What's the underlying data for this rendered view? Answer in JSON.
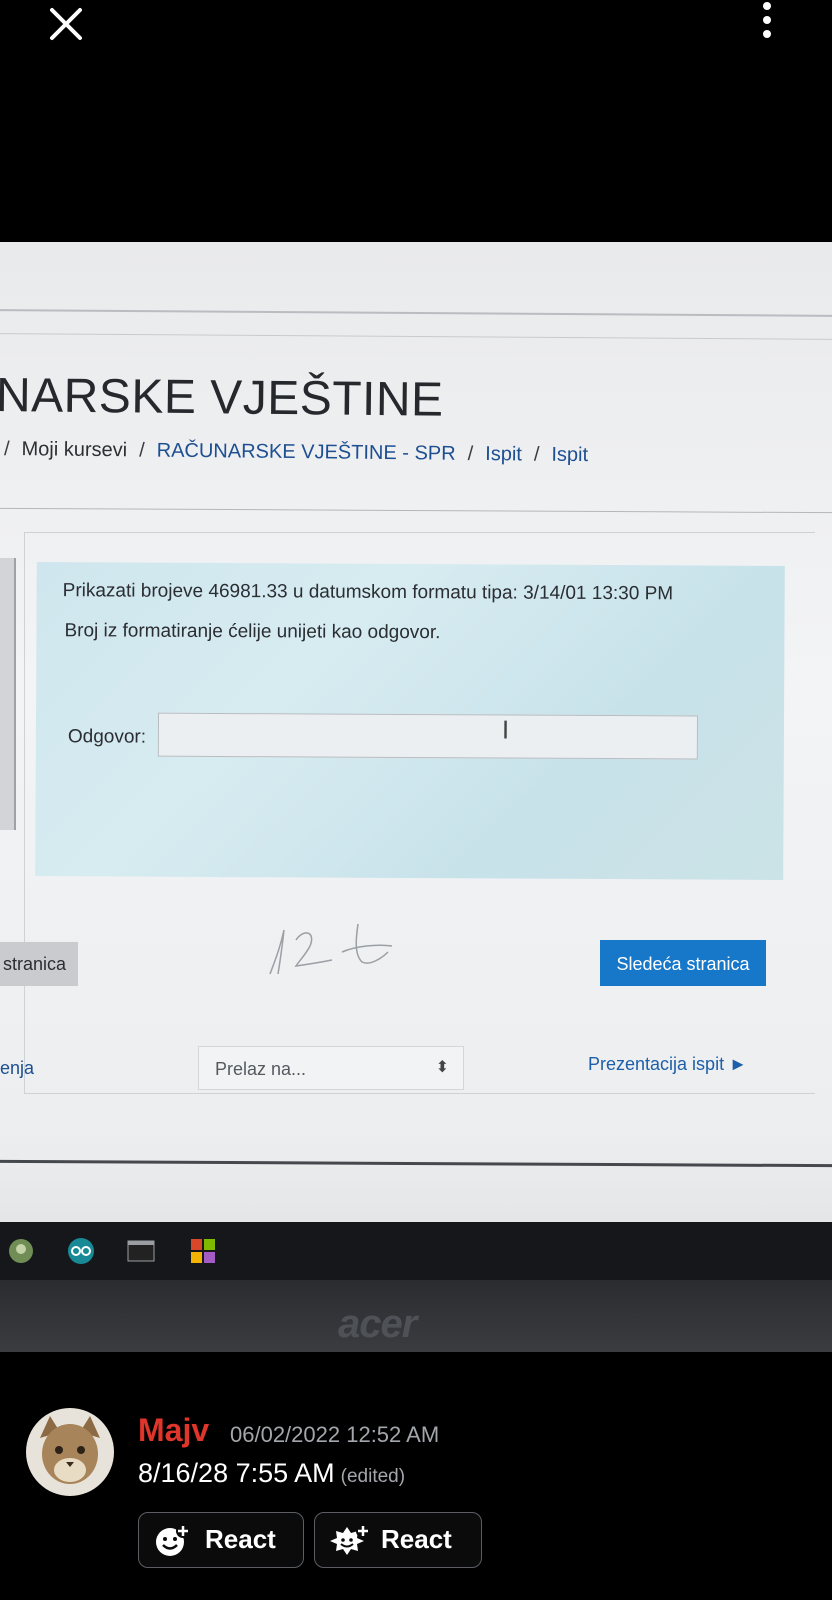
{
  "viewer": {
    "close_icon": "close-icon",
    "more_icon": "more-vertical-icon"
  },
  "screen": {
    "course_title": "NARSKE VJEŠTINE",
    "breadcrumb": [
      "Moji kursevi",
      "RAČUNARSKE VJEŠTINE - SPR",
      "Ispit",
      "Ispit"
    ],
    "question_line1": "Prikazati brojeve 46981.33 u datumskom formatu tipa: 3/14/01 13:30 PM",
    "question_line2": "Broj iz formatiranje ćelije unijeti kao odgovor.",
    "answer_label": "Odgovor:",
    "answer_value": "",
    "prev_button": "stranica",
    "next_button": "Sledeća stranica",
    "nav_left_link": "enja",
    "jump_select": "Prelaz na...",
    "nav_right_link": "Prezentacija ispit ►",
    "bezel_brand": "acer"
  },
  "message": {
    "author": "Majv",
    "author_color": "#e0352a",
    "timestamp": "06/02/2022 12:52 AM",
    "text": "8/16/28 7:55 AM",
    "edited": "(edited)",
    "reactions": [
      {
        "label": "React",
        "icon": "add-reaction-icon"
      },
      {
        "label": "React",
        "icon": "add-super-reaction-icon"
      }
    ]
  }
}
